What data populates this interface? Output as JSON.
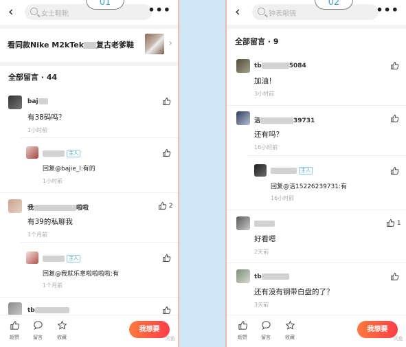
{
  "left": {
    "number": "01",
    "search_placeholder": "女士鞋靴",
    "product_title_a": "看同款Nike M2kTek",
    "product_title_b": "复古老爹鞋",
    "section_title": "全部留言 · 44",
    "comments": [
      {
        "name": "baj",
        "text": "有38码吗？",
        "time": "1小时前",
        "likes": ""
      },
      {
        "name": "",
        "badge": "主人",
        "text": "回复@bajie_l:有的",
        "time": "1小时前",
        "likes": ""
      },
      {
        "name": "我",
        "name_tail": "啦啦",
        "text": "有39的私聊我",
        "time": "1个月前",
        "likes": "2"
      },
      {
        "name": "",
        "badge": "主人",
        "text": "回复@我就乐意啦啦啦啦:有",
        "time": "1个月前",
        "likes": ""
      },
      {
        "name": "tb",
        "text": "",
        "time": "",
        "likes": ""
      }
    ],
    "bottom": {
      "like": "超赞",
      "comment": "留言",
      "fav": "收藏",
      "want": "我想要",
      "watermark": "闲鱼"
    }
  },
  "right": {
    "number": "02",
    "search_placeholder": "钟表眼镜",
    "section_title": "全部留言 · 9",
    "comments": [
      {
        "name": "tb",
        "name_tail": "5084",
        "text": "加油！",
        "time": "3小时前",
        "likes": ""
      },
      {
        "name": "洁",
        "name_tail": "39731",
        "text": "还有吗？",
        "time": "16小时前",
        "likes": ""
      },
      {
        "name": "",
        "badge": "主人",
        "text": "回复@洁15226239731:有",
        "time": "16小时前",
        "likes": ""
      },
      {
        "name": "",
        "text": "好看嗯",
        "time": "2天前",
        "likes": "1"
      },
      {
        "name": "tb",
        "text": "还有没有钢带白盘的了？",
        "time": "3天前",
        "likes": ""
      }
    ],
    "bottom": {
      "like": "超赞",
      "comment": "留言",
      "fav": "收藏",
      "want": "我想要",
      "watermark": "闲鱼"
    }
  },
  "icons": {
    "back": "back-arrow-icon",
    "search": "search-icon",
    "more": "more-icon",
    "like": "thumbs-up-icon",
    "chat": "comment-icon",
    "star": "star-icon"
  }
}
